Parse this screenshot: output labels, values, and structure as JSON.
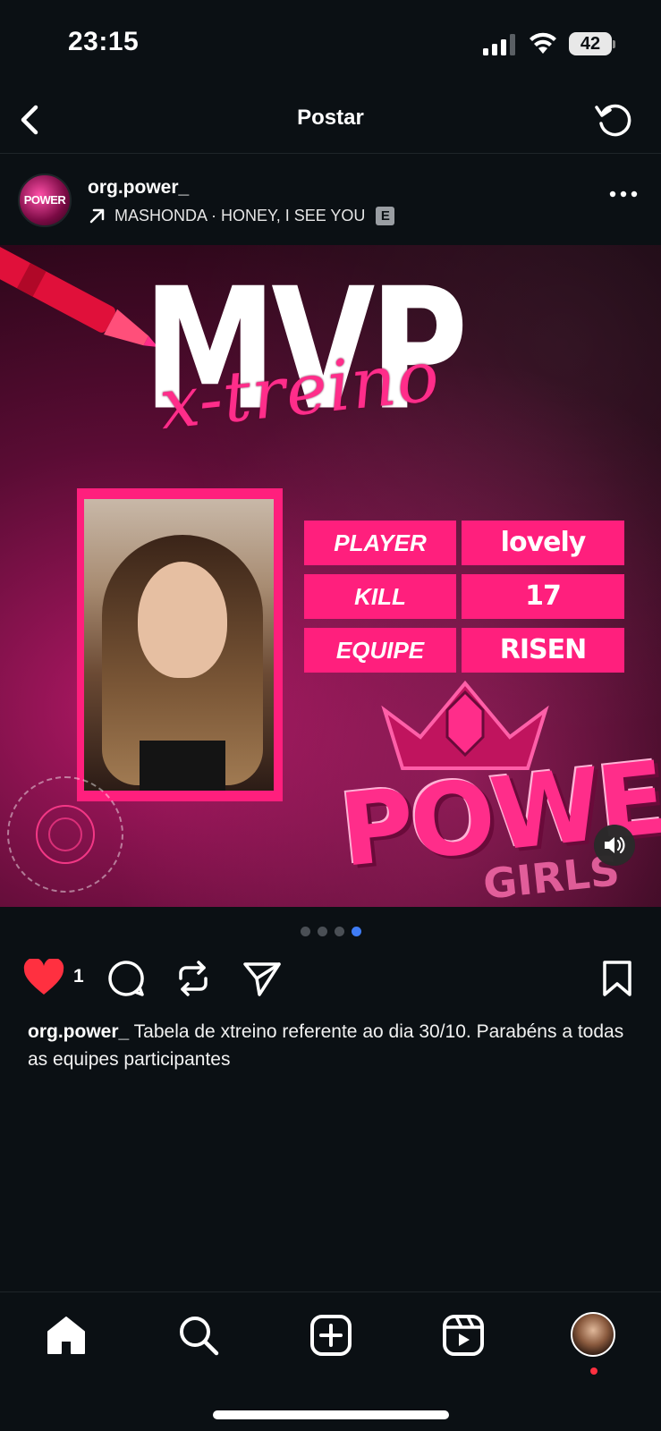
{
  "status_bar": {
    "time": "23:15",
    "battery": "42",
    "icons": [
      "signal-icon",
      "wifi-icon",
      "battery-icon"
    ]
  },
  "header": {
    "title": "Postar",
    "back_icon": "chevron-left-icon",
    "refresh_icon": "refresh-icon"
  },
  "post": {
    "username": "org.power_",
    "avatar_text": "POWER",
    "music": {
      "label": "MASHONDA · HONEY, I SEE YOU",
      "explicit_badge": "E"
    },
    "image": {
      "headline": "MVP",
      "subheadline": "x-treino",
      "stats": [
        {
          "label": "PLAYER",
          "value": "lovely"
        },
        {
          "label": "KILL",
          "value": "17"
        },
        {
          "label": "EQUIPE",
          "value": "RISEN"
        }
      ],
      "logo_main": "POWER",
      "logo_sub": "GIRLS",
      "accent_color": "#ff1f7d"
    },
    "carousel": {
      "count": 4,
      "active_index": 3,
      "active_color": "#3f7cf5"
    },
    "likes": "1",
    "caption": {
      "username": "org.power_",
      "text": "Tabela de xtreino referente ao dia 30/10. Parabéns a todas as equipes participantes"
    }
  },
  "bottom_nav": {
    "items": [
      "home-icon",
      "search-icon",
      "create-icon",
      "reels-icon",
      "profile-avatar"
    ]
  },
  "colors": {
    "background": "#0b1014",
    "like": "#ff3040"
  }
}
